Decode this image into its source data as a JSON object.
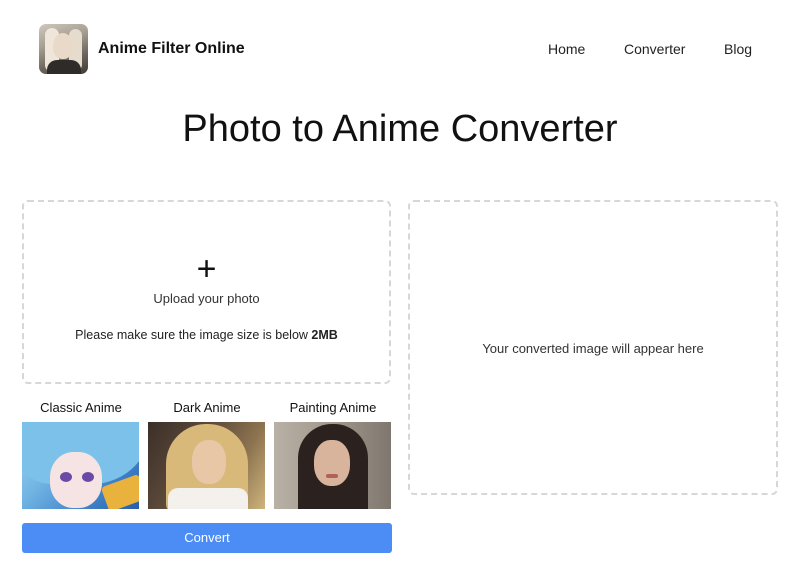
{
  "header": {
    "brand": "Anime Filter Online",
    "logo_icon": "girl-portrait-logo",
    "nav": {
      "home": "Home",
      "converter": "Converter",
      "blog": "Blog"
    }
  },
  "main": {
    "title": "Photo to Anime Converter",
    "upload": {
      "icon": "plus-icon",
      "plus_symbol": "+",
      "label": "Upload your photo",
      "note_prefix": "Please make sure the image size is below ",
      "note_limit": "2MB"
    },
    "result": {
      "placeholder": "Your converted image will appear here"
    },
    "styles": [
      {
        "label": "Classic Anime"
      },
      {
        "label": "Dark Anime"
      },
      {
        "label": "Painting Anime"
      }
    ],
    "convert_label": "Convert"
  },
  "colors": {
    "accent": "#4b8df5",
    "dashed_border": "#d7d7d7"
  }
}
